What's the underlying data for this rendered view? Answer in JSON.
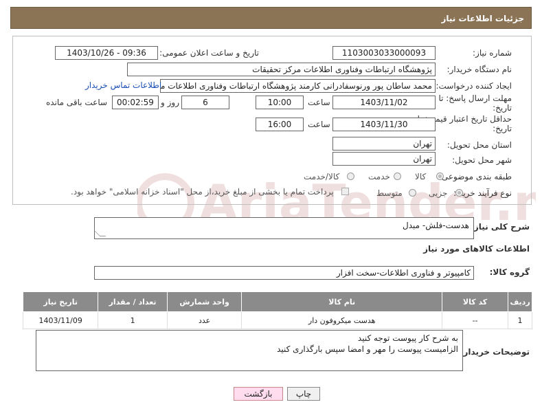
{
  "header": {
    "title": "جزئیات اطلاعات نیاز"
  },
  "form": {
    "need_number_label": "شماره نیاز:",
    "need_number": "1103003033000093",
    "announce_label": "تاریخ و ساعت اعلان عمومی:",
    "announce_value": "1403/10/26 - 09:36",
    "buyer_org_label": "نام دستگاه خریدار:",
    "buyer_org": "پژوهشگاه ارتباطات وفناوری اطلاعات مرکز تحقیقات",
    "creator_label": "ایجاد کننده درخواست:",
    "creator": "محمد ساطان پور ورنوسفادرانی کارمند پژوهشگاه ارتباطات وفناوری اطلاعات مرکز تحقیقات",
    "contact_link": "اطلاعات تماس خریدار",
    "deadline_label": "مهلت ارسال پاسخ: تا تاریخ:",
    "deadline_date": "1403/11/02",
    "time_label": "ساعت",
    "deadline_time": "10:00",
    "days_value": "6",
    "days_label": "روز و",
    "remaining_time": "00:02:59",
    "remaining_label": "ساعت باقی مانده",
    "validity_label": "حداقل تاریخ اعتبار قیمت: تا تاریخ:",
    "validity_date": "1403/11/30",
    "validity_time": "16:00",
    "province_label": "استان محل تحویل:",
    "province": "تهران",
    "city_label": "شهر محل تحویل:",
    "city": "تهران",
    "category_label": "طبقه بندی موضوعی:",
    "category_options": [
      "کالا",
      "خدمت",
      "کالا/خدمت"
    ],
    "process_label": "نوع فرآیند خرید :",
    "process_options": [
      "جزیی",
      "متوسط"
    ],
    "payment_note": "پرداخت تمام یا بخشی از مبلغ خرید،از محل \"اسناد خزانه اسلامی\" خواهد بود."
  },
  "summary": {
    "label": "شرح کلی نیاز:",
    "value": "هدست-فلش- مبدل"
  },
  "goods": {
    "section_title": "اطلاعات کالاهای مورد نیاز",
    "group_label": "گروه کالا:",
    "group_value": "کامپیوتر و فناوری اطلاعات-سخت افزار",
    "columns": [
      "ردیف",
      "کد کالا",
      "نام کالا",
      "واحد شمارش",
      "تعداد / مقدار",
      "تاریخ نیاز"
    ],
    "rows": [
      [
        "1",
        "--",
        "هدست میکروفون دار",
        "عدد",
        "1",
        "1403/11/09"
      ]
    ]
  },
  "notes": {
    "label": "توضیحات خریدار:",
    "line1": "به شرح کار پیوست توجه کنید",
    "line2": "الزامیست پیوست را مهر و امضا سپس بارگذاری کنید"
  },
  "buttons": {
    "print": "چاپ",
    "back": "بازگشت"
  },
  "watermark": {
    "text": "AriaTender.neT"
  }
}
